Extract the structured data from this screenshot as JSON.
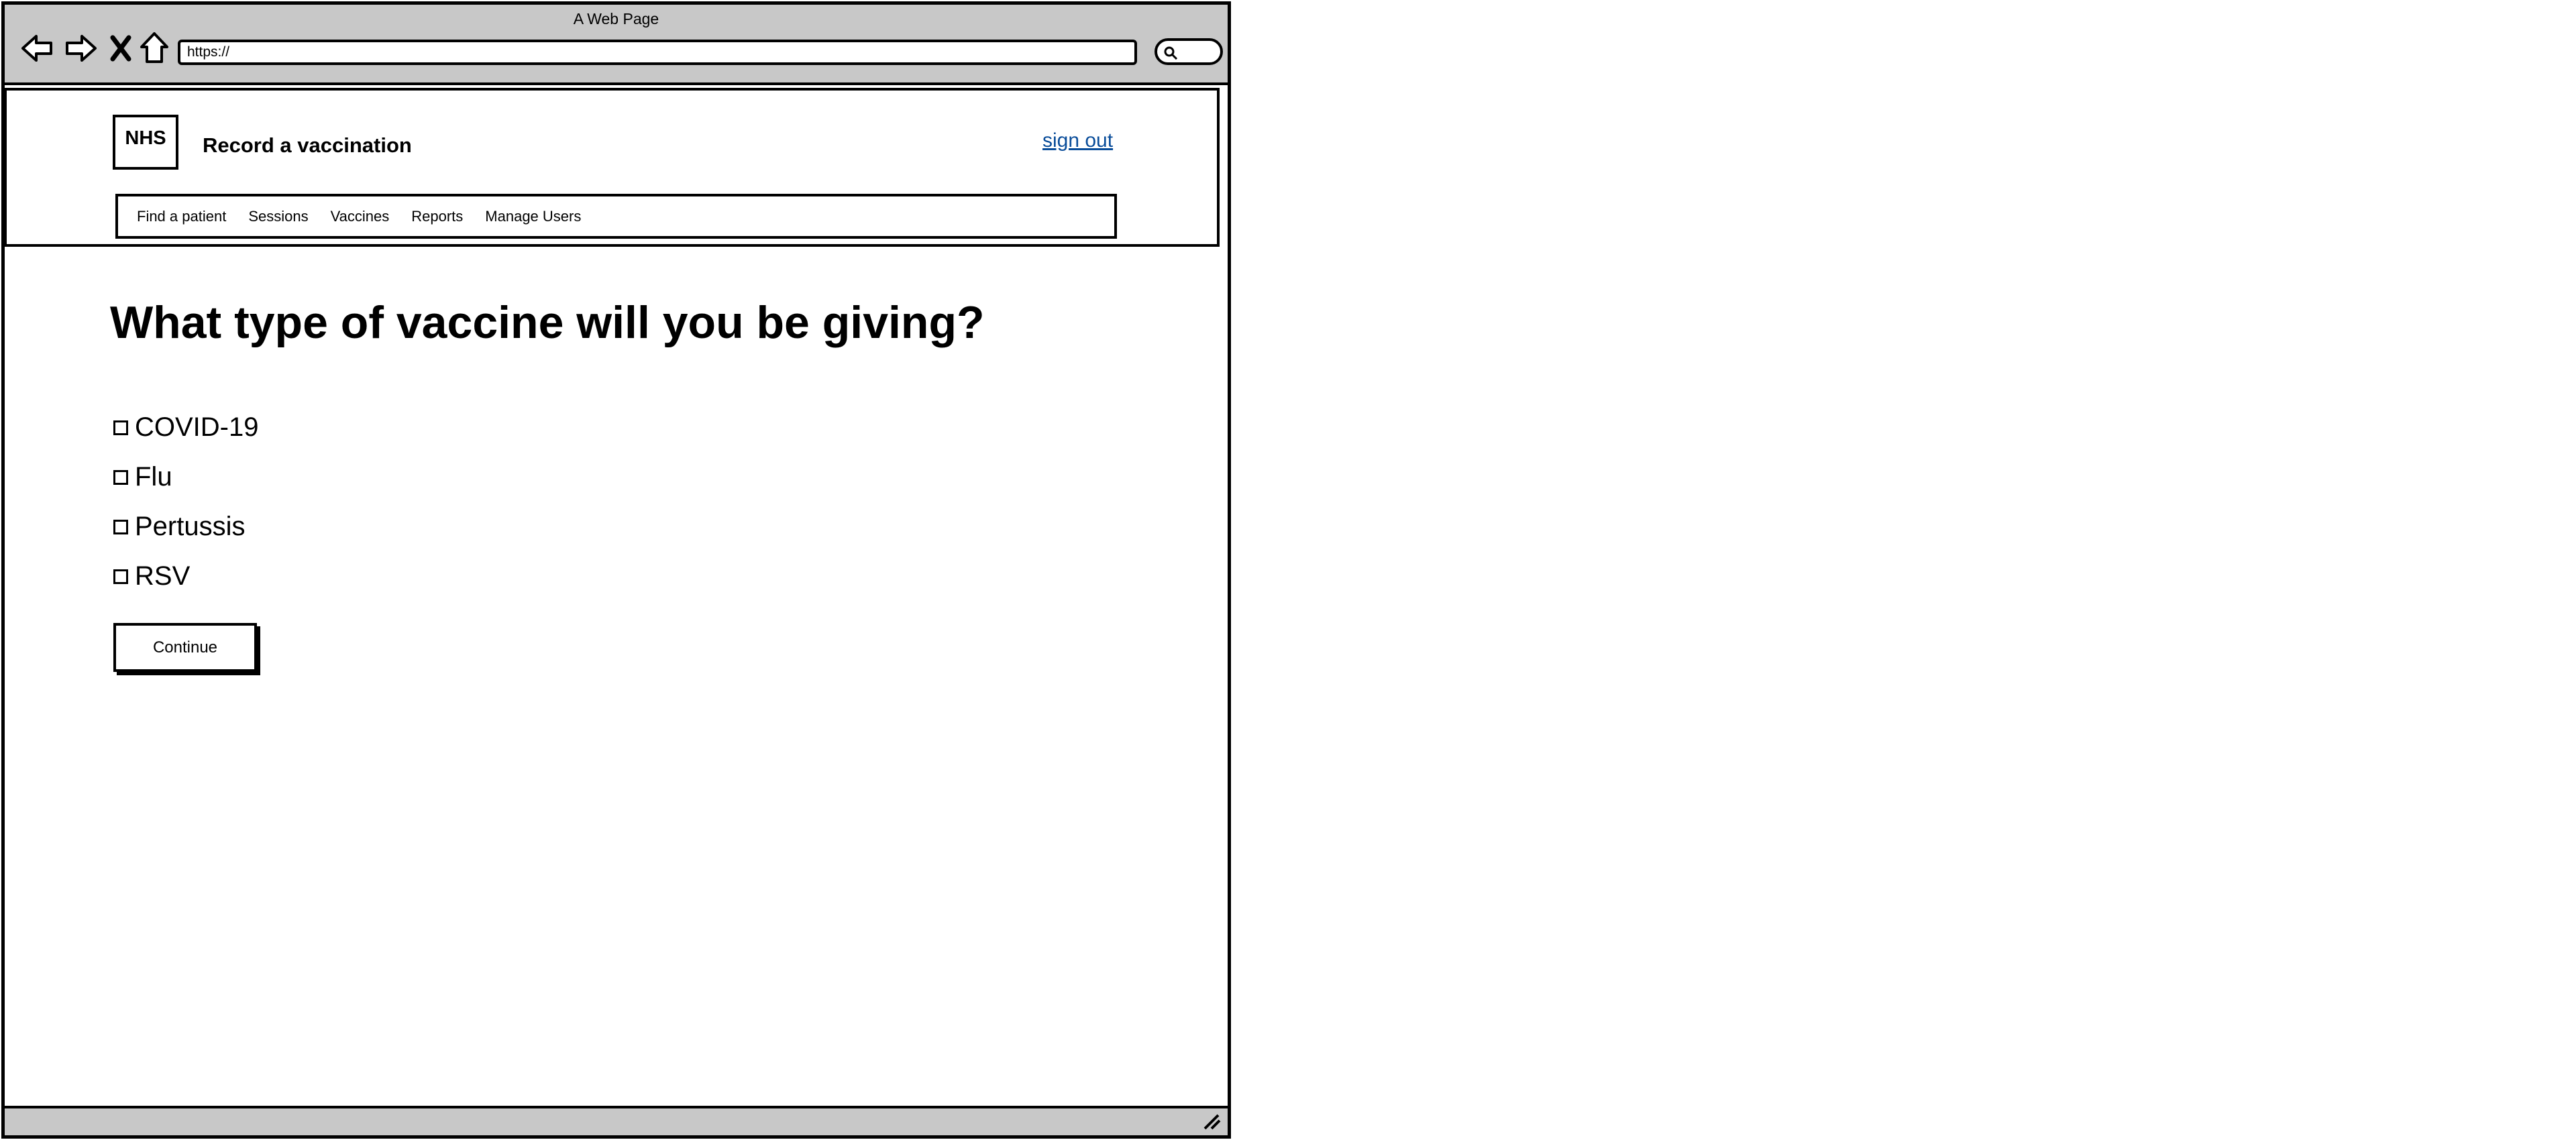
{
  "window": {
    "title": "A Web Page",
    "address": "https://"
  },
  "toolbar": {
    "icons": [
      "back-arrow-icon",
      "forward-arrow-icon",
      "stop-icon",
      "home-icon",
      "search-icon"
    ]
  },
  "header": {
    "logo_text": "NHS",
    "service_name": "Record a vaccination",
    "sign_out": "sign out"
  },
  "nav": {
    "items": [
      "Find a patient",
      "Sessions",
      "Vaccines",
      "Reports",
      "Manage Users"
    ]
  },
  "main": {
    "title": "What type of vaccine will you be giving?",
    "options": [
      {
        "label": "COVID-19",
        "checked": false
      },
      {
        "label": "Flu",
        "checked": false
      },
      {
        "label": "Pertussis",
        "checked": false
      },
      {
        "label": "RSV",
        "checked": false
      }
    ],
    "continue_label": "Continue"
  },
  "colors": {
    "chrome": "#c8c8c8",
    "link": "#0a4d9a"
  }
}
